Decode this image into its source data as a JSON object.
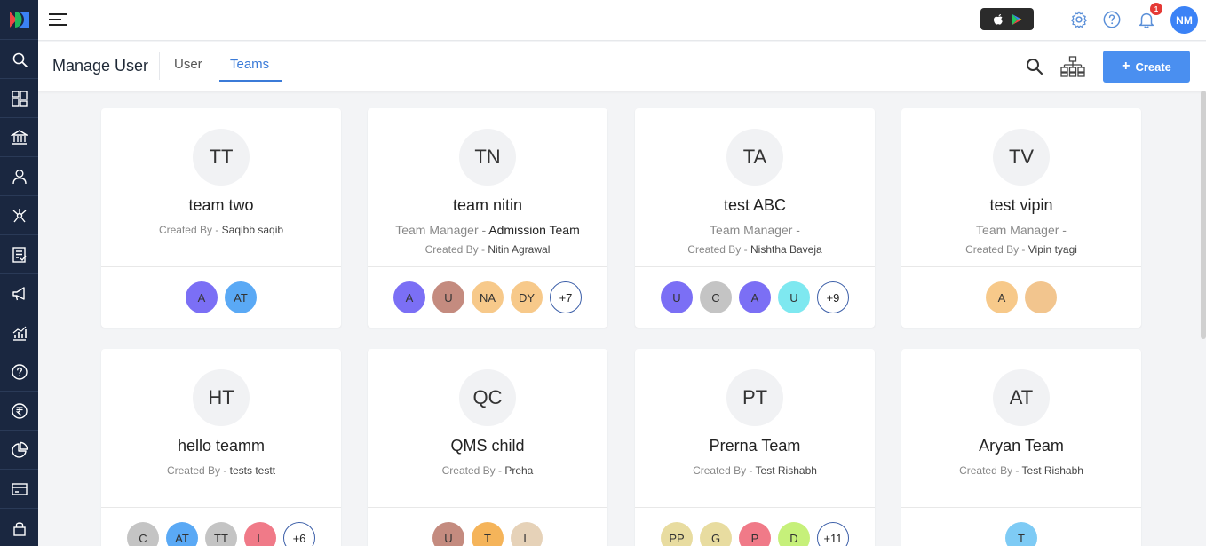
{
  "app": {
    "user_initials": "NM",
    "notification_count": "1"
  },
  "header": {
    "title": "Manage User",
    "tabs": [
      {
        "label": "User"
      },
      {
        "label": "Teams"
      }
    ],
    "create_label": "Create"
  },
  "sidebar": {
    "items": [
      {
        "icon": "search-icon"
      },
      {
        "icon": "dashboard-icon"
      },
      {
        "icon": "institution-icon"
      },
      {
        "icon": "user-icon"
      },
      {
        "icon": "network-icon"
      },
      {
        "icon": "checklist-icon"
      },
      {
        "icon": "megaphone-icon"
      },
      {
        "icon": "analytics-icon"
      },
      {
        "icon": "help-icon"
      },
      {
        "icon": "rupee-icon"
      },
      {
        "icon": "pie-chart-icon"
      },
      {
        "icon": "card-icon"
      },
      {
        "icon": "lock-icon"
      }
    ]
  },
  "teams": [
    {
      "initials": "TT",
      "name": "team two",
      "manager_label": "",
      "manager_name": "",
      "created_label": "Created By - ",
      "created_name": "Saqibb saqib",
      "members": [
        {
          "label": "A",
          "color": "#7b6ff5"
        },
        {
          "label": "AT",
          "color": "#5aa9f5"
        }
      ],
      "more": ""
    },
    {
      "initials": "TN",
      "name": "team nitin",
      "manager_label": "Team Manager - ",
      "manager_name": "Admission Team",
      "created_label": "Created By - ",
      "created_name": "Nitin Agrawal",
      "members": [
        {
          "label": "A",
          "color": "#7b6ff5"
        },
        {
          "label": "U",
          "color": "#c48b7f"
        },
        {
          "label": "NA",
          "color": "#f7c98a"
        },
        {
          "label": "DY",
          "color": "#f7c98a"
        }
      ],
      "more": "+7"
    },
    {
      "initials": "TA",
      "name": "test ABC",
      "manager_label": "Team Manager -",
      "manager_name": "",
      "created_label": "Created By - ",
      "created_name": "Nishtha Baveja",
      "members": [
        {
          "label": "U",
          "color": "#7b6ff5"
        },
        {
          "label": "C",
          "color": "#c4c4c4"
        },
        {
          "label": "A",
          "color": "#7b6ff5"
        },
        {
          "label": "U",
          "color": "#7ee8f0"
        }
      ],
      "more": "+9"
    },
    {
      "initials": "TV",
      "name": "test vipin",
      "manager_label": "Team Manager -",
      "manager_name": "",
      "created_label": "Created By - ",
      "created_name": "Vipin tyagi",
      "members": [
        {
          "label": "A",
          "color": "#f7c98a"
        },
        {
          "label": "",
          "color": "#f2c58e"
        }
      ],
      "more": ""
    },
    {
      "initials": "HT",
      "name": "hello teamm",
      "manager_label": "",
      "manager_name": "",
      "created_label": "Created By - ",
      "created_name": "tests testt",
      "members": [
        {
          "label": "C",
          "color": "#c4c4c4"
        },
        {
          "label": "AT",
          "color": "#5aa9f5"
        },
        {
          "label": "TT",
          "color": "#c4c4c4"
        },
        {
          "label": "L",
          "color": "#f07a88"
        }
      ],
      "more": "+6"
    },
    {
      "initials": "QC",
      "name": "QMS child",
      "manager_label": "",
      "manager_name": "",
      "created_label": "Created By - ",
      "created_name": "Preha",
      "members": [
        {
          "label": "U",
          "color": "#c48b7f"
        },
        {
          "label": "T",
          "color": "#f5b45a"
        },
        {
          "label": "L",
          "color": "#e6d2b8"
        }
      ],
      "more": ""
    },
    {
      "initials": "PT",
      "name": "Prerna Team",
      "manager_label": "",
      "manager_name": "",
      "created_label": "Created By - ",
      "created_name": "Test Rishabh",
      "members": [
        {
          "label": "PP",
          "color": "#e8dca0"
        },
        {
          "label": "G",
          "color": "#e8dca0"
        },
        {
          "label": "P",
          "color": "#f07a88"
        },
        {
          "label": "D",
          "color": "#c6f07a"
        }
      ],
      "more": "+11"
    },
    {
      "initials": "AT",
      "name": "Aryan Team",
      "manager_label": "",
      "manager_name": "",
      "created_label": "Created By - ",
      "created_name": "Test Rishabh",
      "members": [
        {
          "label": "T",
          "color": "#7ecbf5"
        }
      ],
      "more": ""
    }
  ]
}
